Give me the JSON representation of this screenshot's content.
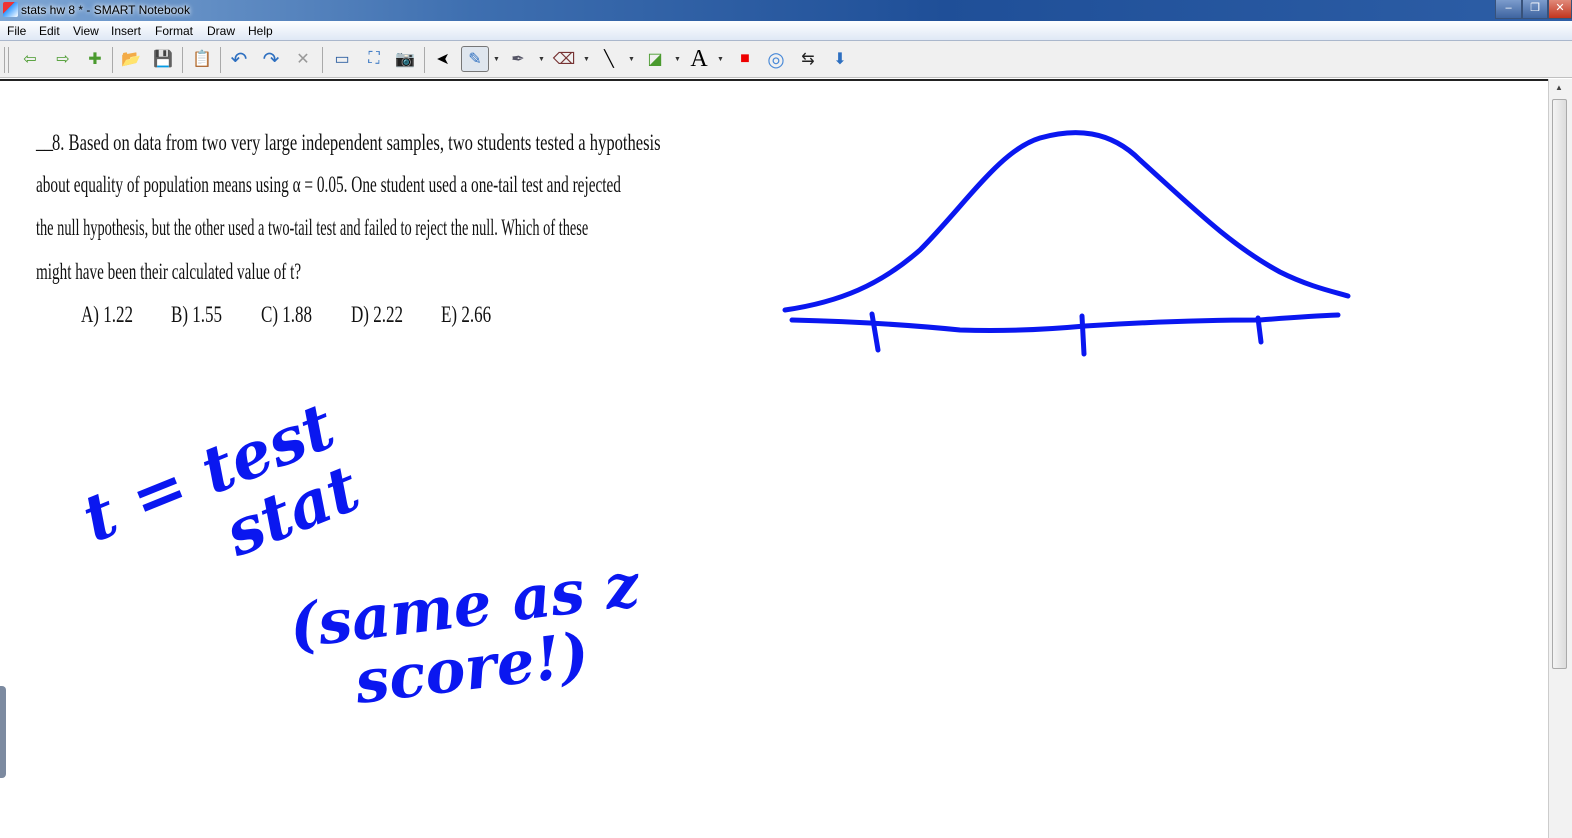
{
  "window": {
    "title": "stats hw 8 * - SMART Notebook",
    "minimize": "–",
    "restore": "❐",
    "close": "✕"
  },
  "menu": [
    "File",
    "Edit",
    "View",
    "Insert",
    "Format",
    "Draw",
    "Help"
  ],
  "toolbar": [
    {
      "name": "previous-page-icon",
      "glyph": "⇦"
    },
    {
      "name": "next-page-icon",
      "glyph": "⇨"
    },
    {
      "name": "add-page-icon",
      "glyph": "✚"
    },
    {
      "name": "open-icon",
      "glyph": "📂"
    },
    {
      "name": "save-icon",
      "glyph": "💾"
    },
    {
      "name": "paste-icon",
      "glyph": "📋"
    },
    {
      "name": "undo-icon",
      "glyph": "↶"
    },
    {
      "name": "redo-icon",
      "glyph": "↷"
    },
    {
      "name": "delete-icon",
      "glyph": "✕"
    },
    {
      "name": "screen-shade-icon",
      "glyph": "▭"
    },
    {
      "name": "full-screen-icon",
      "glyph": "⛶"
    },
    {
      "name": "capture-icon",
      "glyph": "📷"
    },
    {
      "name": "select-icon",
      "glyph": "➤"
    },
    {
      "name": "pen-icon",
      "glyph": "✎"
    },
    {
      "name": "creative-pen-icon",
      "glyph": "✒"
    },
    {
      "name": "eraser-icon",
      "glyph": "⌫"
    },
    {
      "name": "line-icon",
      "glyph": "╲"
    },
    {
      "name": "shapes-icon",
      "glyph": "◪"
    },
    {
      "name": "text-icon",
      "glyph": "A"
    },
    {
      "name": "fill-color-icon",
      "glyph": "■"
    },
    {
      "name": "properties-icon",
      "glyph": "◎"
    },
    {
      "name": "move-toolbar-icon",
      "glyph": "⇆"
    },
    {
      "name": "more-icon",
      "glyph": "⬇"
    }
  ],
  "question": {
    "blank": "__",
    "lines": [
      "8.    Based on data from two very large independent samples, two students tested a hypothesis",
      "about equality of population means using  α = 0.05. One student used a one-tail test and rejected",
      "the null hypothesis, but the other used a two-tail test and failed to reject the null. Which of these",
      "might have been their calculated value of t?"
    ],
    "choices": [
      "A) 1.22",
      "B) 1.55",
      "C) 1.88",
      "D) 2.22",
      "E) 2.66"
    ]
  },
  "ink": {
    "color": "#0a17f0",
    "notes": [
      "t = test stat",
      "(same as z score!)"
    ],
    "sketch": "normal curve with three tick marks"
  }
}
